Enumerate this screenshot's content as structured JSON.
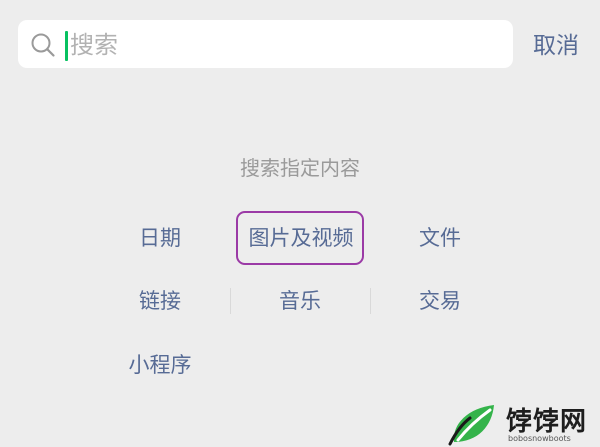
{
  "search": {
    "placeholder": "搜索",
    "value": "",
    "cancel_label": "取消"
  },
  "section_title": "搜索指定内容",
  "options": [
    {
      "label": "日期"
    },
    {
      "label": "图片及视频",
      "highlighted": true
    },
    {
      "label": "文件"
    },
    {
      "label": "链接"
    },
    {
      "label": "音乐"
    },
    {
      "label": "交易"
    },
    {
      "label": "小程序"
    }
  ],
  "watermark": {
    "name": "饽饽网",
    "domain": "bobosnowboots"
  },
  "colors": {
    "background": "#ededed",
    "link": "#576b95",
    "caret": "#07c160",
    "highlight": "#9b3aa6",
    "muted": "#9a9a9a"
  }
}
